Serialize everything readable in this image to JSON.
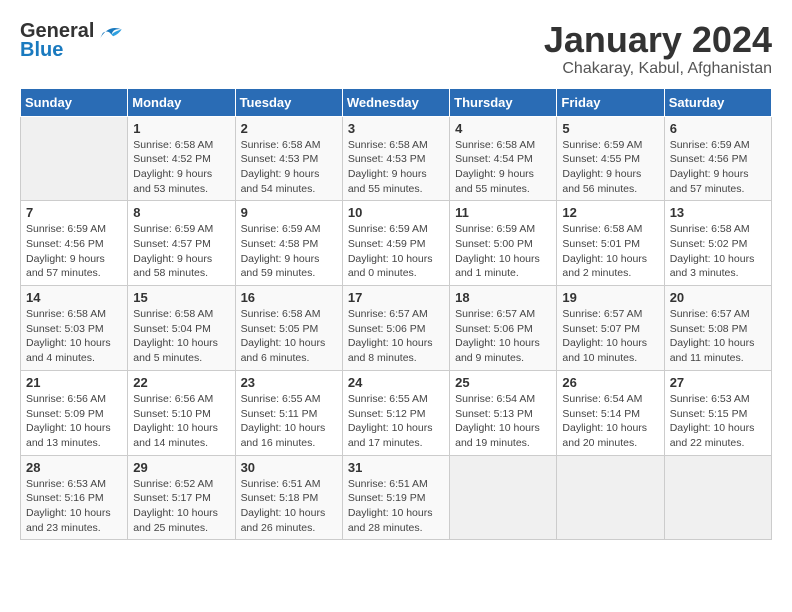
{
  "logo": {
    "general": "General",
    "blue": "Blue"
  },
  "title": {
    "month": "January 2024",
    "location": "Chakaray, Kabul, Afghanistan"
  },
  "headers": [
    "Sunday",
    "Monday",
    "Tuesday",
    "Wednesday",
    "Thursday",
    "Friday",
    "Saturday"
  ],
  "weeks": [
    [
      {
        "day": "",
        "info": ""
      },
      {
        "day": "1",
        "info": "Sunrise: 6:58 AM\nSunset: 4:52 PM\nDaylight: 9 hours\nand 53 minutes."
      },
      {
        "day": "2",
        "info": "Sunrise: 6:58 AM\nSunset: 4:53 PM\nDaylight: 9 hours\nand 54 minutes."
      },
      {
        "day": "3",
        "info": "Sunrise: 6:58 AM\nSunset: 4:53 PM\nDaylight: 9 hours\nand 55 minutes."
      },
      {
        "day": "4",
        "info": "Sunrise: 6:58 AM\nSunset: 4:54 PM\nDaylight: 9 hours\nand 55 minutes."
      },
      {
        "day": "5",
        "info": "Sunrise: 6:59 AM\nSunset: 4:55 PM\nDaylight: 9 hours\nand 56 minutes."
      },
      {
        "day": "6",
        "info": "Sunrise: 6:59 AM\nSunset: 4:56 PM\nDaylight: 9 hours\nand 57 minutes."
      }
    ],
    [
      {
        "day": "7",
        "info": "Sunrise: 6:59 AM\nSunset: 4:56 PM\nDaylight: 9 hours\nand 57 minutes."
      },
      {
        "day": "8",
        "info": "Sunrise: 6:59 AM\nSunset: 4:57 PM\nDaylight: 9 hours\nand 58 minutes."
      },
      {
        "day": "9",
        "info": "Sunrise: 6:59 AM\nSunset: 4:58 PM\nDaylight: 9 hours\nand 59 minutes."
      },
      {
        "day": "10",
        "info": "Sunrise: 6:59 AM\nSunset: 4:59 PM\nDaylight: 10 hours\nand 0 minutes."
      },
      {
        "day": "11",
        "info": "Sunrise: 6:59 AM\nSunset: 5:00 PM\nDaylight: 10 hours\nand 1 minute."
      },
      {
        "day": "12",
        "info": "Sunrise: 6:58 AM\nSunset: 5:01 PM\nDaylight: 10 hours\nand 2 minutes."
      },
      {
        "day": "13",
        "info": "Sunrise: 6:58 AM\nSunset: 5:02 PM\nDaylight: 10 hours\nand 3 minutes."
      }
    ],
    [
      {
        "day": "14",
        "info": "Sunrise: 6:58 AM\nSunset: 5:03 PM\nDaylight: 10 hours\nand 4 minutes."
      },
      {
        "day": "15",
        "info": "Sunrise: 6:58 AM\nSunset: 5:04 PM\nDaylight: 10 hours\nand 5 minutes."
      },
      {
        "day": "16",
        "info": "Sunrise: 6:58 AM\nSunset: 5:05 PM\nDaylight: 10 hours\nand 6 minutes."
      },
      {
        "day": "17",
        "info": "Sunrise: 6:57 AM\nSunset: 5:06 PM\nDaylight: 10 hours\nand 8 minutes."
      },
      {
        "day": "18",
        "info": "Sunrise: 6:57 AM\nSunset: 5:06 PM\nDaylight: 10 hours\nand 9 minutes."
      },
      {
        "day": "19",
        "info": "Sunrise: 6:57 AM\nSunset: 5:07 PM\nDaylight: 10 hours\nand 10 minutes."
      },
      {
        "day": "20",
        "info": "Sunrise: 6:57 AM\nSunset: 5:08 PM\nDaylight: 10 hours\nand 11 minutes."
      }
    ],
    [
      {
        "day": "21",
        "info": "Sunrise: 6:56 AM\nSunset: 5:09 PM\nDaylight: 10 hours\nand 13 minutes."
      },
      {
        "day": "22",
        "info": "Sunrise: 6:56 AM\nSunset: 5:10 PM\nDaylight: 10 hours\nand 14 minutes."
      },
      {
        "day": "23",
        "info": "Sunrise: 6:55 AM\nSunset: 5:11 PM\nDaylight: 10 hours\nand 16 minutes."
      },
      {
        "day": "24",
        "info": "Sunrise: 6:55 AM\nSunset: 5:12 PM\nDaylight: 10 hours\nand 17 minutes."
      },
      {
        "day": "25",
        "info": "Sunrise: 6:54 AM\nSunset: 5:13 PM\nDaylight: 10 hours\nand 19 minutes."
      },
      {
        "day": "26",
        "info": "Sunrise: 6:54 AM\nSunset: 5:14 PM\nDaylight: 10 hours\nand 20 minutes."
      },
      {
        "day": "27",
        "info": "Sunrise: 6:53 AM\nSunset: 5:15 PM\nDaylight: 10 hours\nand 22 minutes."
      }
    ],
    [
      {
        "day": "28",
        "info": "Sunrise: 6:53 AM\nSunset: 5:16 PM\nDaylight: 10 hours\nand 23 minutes."
      },
      {
        "day": "29",
        "info": "Sunrise: 6:52 AM\nSunset: 5:17 PM\nDaylight: 10 hours\nand 25 minutes."
      },
      {
        "day": "30",
        "info": "Sunrise: 6:51 AM\nSunset: 5:18 PM\nDaylight: 10 hours\nand 26 minutes."
      },
      {
        "day": "31",
        "info": "Sunrise: 6:51 AM\nSunset: 5:19 PM\nDaylight: 10 hours\nand 28 minutes."
      },
      {
        "day": "",
        "info": ""
      },
      {
        "day": "",
        "info": ""
      },
      {
        "day": "",
        "info": ""
      }
    ]
  ]
}
